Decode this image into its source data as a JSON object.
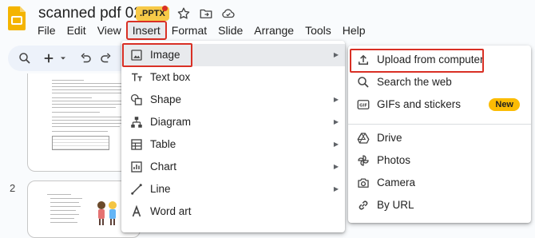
{
  "header": {
    "doc_title": "scanned pdf 02",
    "file_badge": ".PPTX",
    "icons": [
      "star-icon",
      "move-to-folder-icon",
      "cloud-saved-icon"
    ]
  },
  "menubar": {
    "items": [
      "File",
      "Edit",
      "View",
      "Insert",
      "Format",
      "Slide",
      "Arrange",
      "Tools",
      "Help"
    ],
    "active": "Insert"
  },
  "toolbar": {
    "icons": [
      "zoom-icon",
      "add-icon",
      "dropdown-icon",
      "undo-icon",
      "redo-icon"
    ]
  },
  "slides": {
    "second_number": "2"
  },
  "insert_menu": {
    "items": [
      {
        "label": "Image",
        "icon": "image-icon",
        "submenu": true
      },
      {
        "label": "Text box",
        "icon": "text-box-icon",
        "submenu": false
      },
      {
        "label": "Shape",
        "icon": "shape-icon",
        "submenu": true
      },
      {
        "label": "Diagram",
        "icon": "diagram-icon",
        "submenu": true
      },
      {
        "label": "Table",
        "icon": "table-icon",
        "submenu": true
      },
      {
        "label": "Chart",
        "icon": "chart-icon",
        "submenu": true
      },
      {
        "label": "Line",
        "icon": "line-icon",
        "submenu": true
      },
      {
        "label": "Word art",
        "icon": "word-art-icon",
        "submenu": false
      }
    ]
  },
  "image_submenu": {
    "items": [
      {
        "label": "Upload from computer",
        "icon": "upload-icon"
      },
      {
        "label": "Search the web",
        "icon": "search-icon"
      },
      {
        "label": "GIFs and stickers",
        "icon": "gif-icon",
        "badge": "New"
      },
      {
        "label": "Drive",
        "icon": "drive-icon"
      },
      {
        "label": "Photos",
        "icon": "photos-icon"
      },
      {
        "label": "Camera",
        "icon": "camera-icon"
      },
      {
        "label": "By URL",
        "icon": "link-icon"
      }
    ]
  },
  "colors": {
    "highlight_box": "#d93025",
    "badge_bg": "#f7c948",
    "new_badge_bg": "#fbbc04",
    "app_icon": "#f4b400"
  }
}
